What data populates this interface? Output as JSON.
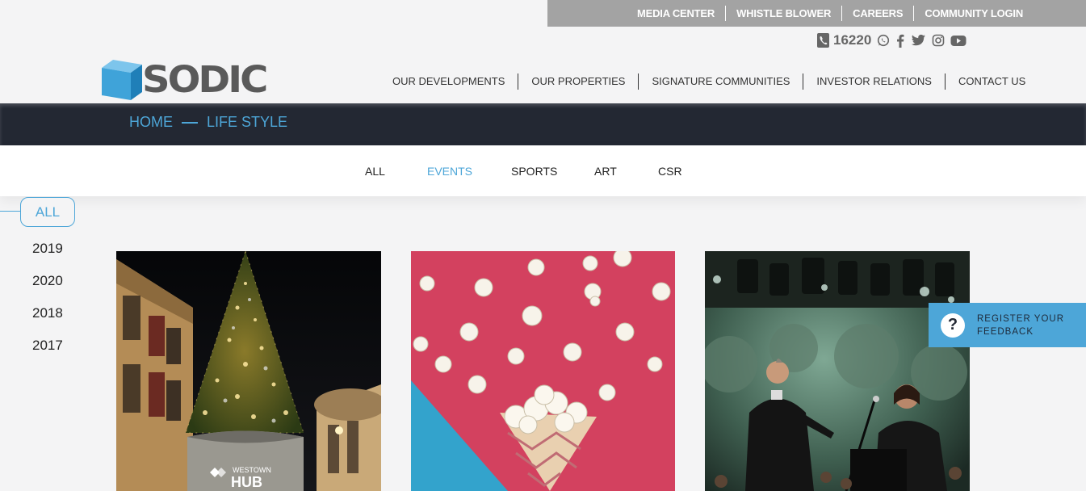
{
  "utility_nav": [
    "MEDIA CENTER",
    "WHISTLE BLOWER",
    "CAREERS",
    "COMMUNITY LOGIN"
  ],
  "contact": {
    "phone": "16220",
    "social_icons": [
      "whatsapp-icon",
      "facebook-icon",
      "twitter-icon",
      "instagram-icon",
      "youtube-icon"
    ]
  },
  "logo": {
    "text": "SODIC",
    "brand_color": "#3fa3d9"
  },
  "main_nav": [
    "OUR DEVELOPMENTS",
    "OUR PROPERTIES",
    "SIGNATURE COMMUNITIES",
    "INVESTOR RELATIONS",
    "CONTACT US"
  ],
  "breadcrumb": {
    "home": "HOME",
    "current": "LIFE STYLE"
  },
  "filter_tabs": {
    "all": "ALL",
    "events": "EVENTS",
    "sports": "SPORTS",
    "art": "ART",
    "csr": "CSR",
    "active": "EVENTS"
  },
  "years": {
    "all": "ALL",
    "items": [
      "2019",
      "2020",
      "2018",
      "2017"
    ]
  },
  "cards": [
    {
      "image": "christmas-tree-photo",
      "sign": "WESTOWN",
      "sign2": "HUB"
    },
    {
      "image": "popcorn-cone-photo"
    },
    {
      "image": "concert-performers-photo"
    }
  ],
  "feedback": {
    "label": "REGISTER YOUR FEEDBACK",
    "icon": "question-icon"
  },
  "colors": {
    "accent": "#4da6d8",
    "dark_bar": "#232833",
    "utility_bar": "#a3a3a3"
  }
}
